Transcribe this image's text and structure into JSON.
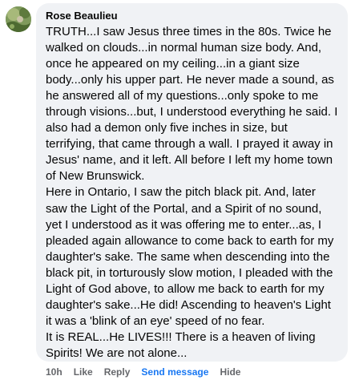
{
  "comment": {
    "author": "Rose Beaulieu",
    "text": "TRUTH...I saw Jesus three times in the 80s. Twice he walked on clouds...in normal human size body. And, once he appeared on my ceiling...in a giant size body...only his upper part. He never made a sound, as he answered all of my questions...only spoke to me through visions...but, I understood everything he said. I also had a demon only five inches in size, but terrifying, that came through a wall. I prayed it away in Jesus' name, and it left. All before I left my home town of New Brunswick.\nHere in Ontario, I saw the pitch black pit. And, later saw the Light of the Portal, and a Spirit of no sound, yet I understood as it was offering me to enter...as, I pleaded again allowance to come back to earth for my daughter's sake. The same when descending into the black pit, in torturously slow motion, I pleaded with the Light of God above, to allow me back to earth for my daughter's sake...He did! Ascending to heaven's Light it was a 'blink of an eye' speed of no fear.\nIt is REAL...He LIVES!!! There is a heaven of living Spirits! We are not alone...",
    "avatar_icon": "profile-photo-nature"
  },
  "actions": {
    "timestamp": "10h",
    "like_label": "Like",
    "reply_label": "Reply",
    "send_message_label": "Send message",
    "hide_label": "Hide"
  },
  "colors": {
    "bubble_background": "#f0f2f5",
    "text_primary": "#050505",
    "text_secondary": "#65676b",
    "link_blue": "#1877f2"
  }
}
